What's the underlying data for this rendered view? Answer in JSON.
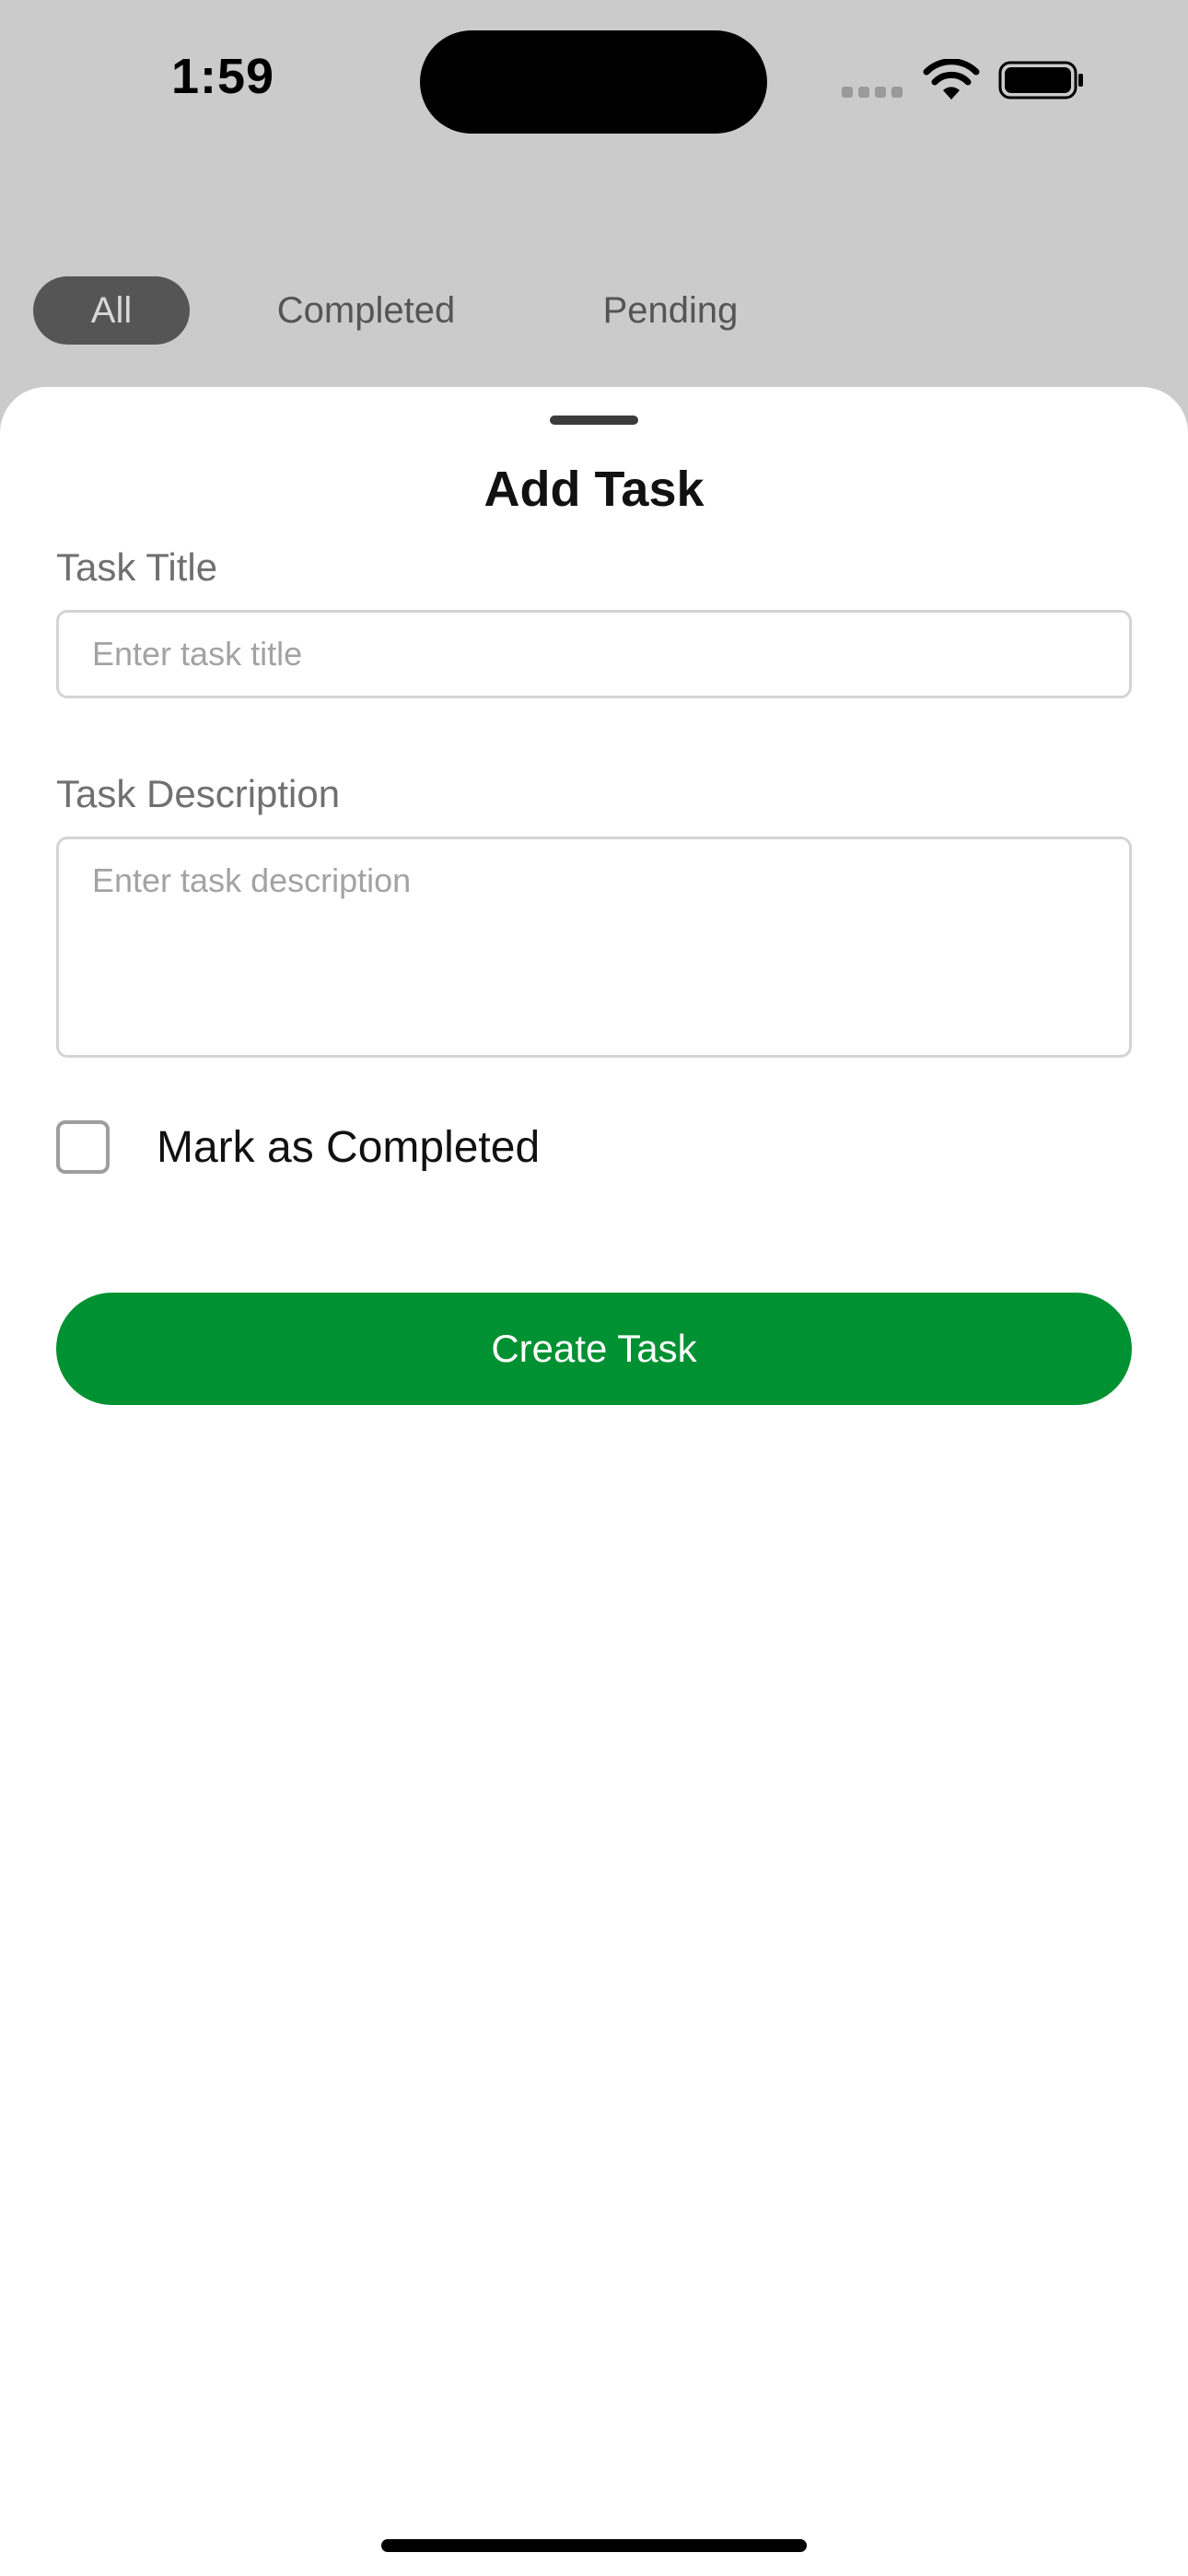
{
  "status_bar": {
    "time": "1:59",
    "icons": [
      "signal-icon",
      "wifi-icon",
      "battery-icon"
    ]
  },
  "filters": {
    "tabs": [
      {
        "label": "All",
        "active": true
      },
      {
        "label": "Completed",
        "active": false
      },
      {
        "label": "Pending",
        "active": false
      }
    ]
  },
  "sheet": {
    "title": "Add Task",
    "task_title": {
      "label": "Task Title",
      "value": "",
      "placeholder": "Enter task title"
    },
    "task_description": {
      "label": "Task Description",
      "value": "",
      "placeholder": "Enter task description"
    },
    "mark_completed": {
      "label": "Mark as Completed",
      "checked": false
    },
    "create_button": "Create Task"
  },
  "colors": {
    "backdrop": "#cbcbcb",
    "active_tab": "#555555",
    "primary_button": "#009132",
    "sheet_background": "#ffffff"
  }
}
